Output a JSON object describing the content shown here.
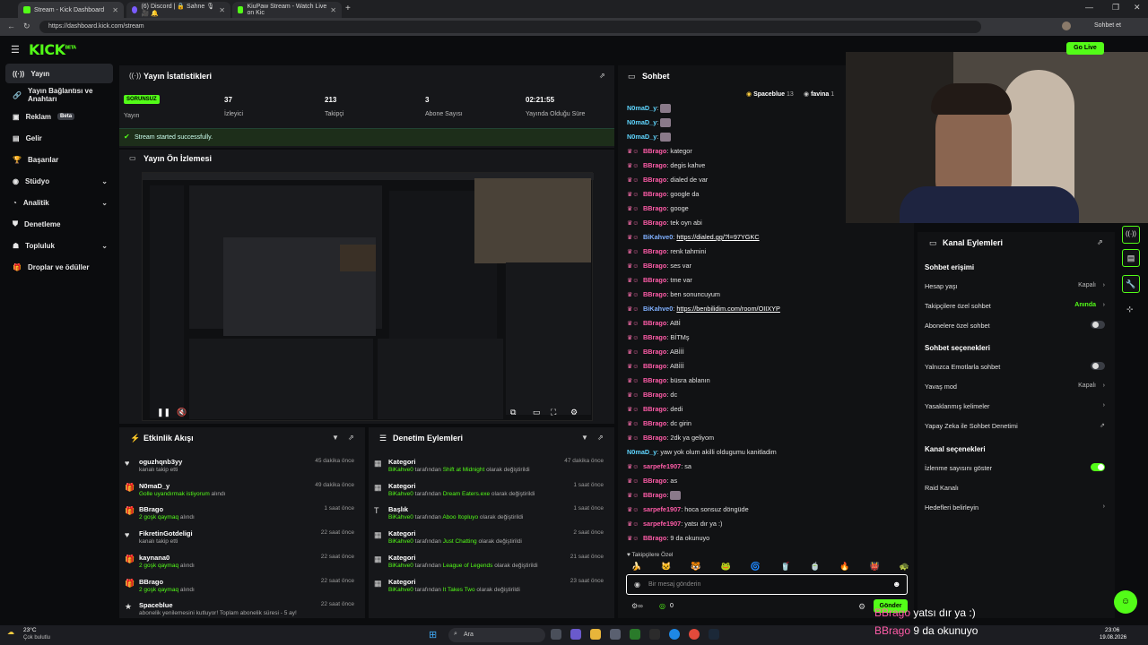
{
  "browser": {
    "tabs": [
      {
        "label": "Stream - Kick Dashboard",
        "active": true
      },
      {
        "label": "(6) Discord | 🔒 Sahne 🎙 🎥 🔔",
        "active": false
      },
      {
        "label": "KiuPaw Stream - Watch Live on Kic",
        "active": false
      }
    ],
    "url": "https://dashboard.kick.com/stream",
    "profile_button": "Sohbet et"
  },
  "header": {
    "logo": "KICK",
    "logo_sup": "BETA",
    "go_live": "Go Live"
  },
  "sidebar": {
    "items": [
      {
        "label": "Yayın",
        "icon": "broadcast-icon",
        "active": true
      },
      {
        "label": "Yayın Bağlantısı ve Anahtarı",
        "icon": "link-icon"
      },
      {
        "label": "Reklam",
        "icon": "ad-icon",
        "badge": "Beta"
      },
      {
        "label": "Gelir",
        "icon": "revenue-icon"
      },
      {
        "label": "Başarılar",
        "icon": "trophy-icon"
      },
      {
        "label": "Stüdyo",
        "icon": "studio-icon",
        "chevron": true
      },
      {
        "label": "Analitik",
        "icon": "analytics-icon",
        "chevron": true
      },
      {
        "label": "Denetleme",
        "icon": "moderation-icon"
      },
      {
        "label": "Topluluk",
        "icon": "community-icon",
        "chevron": true
      },
      {
        "label": "Droplar ve ödüller",
        "icon": "gift-icon"
      }
    ]
  },
  "stats": {
    "title": "Yayın İstatistikleri",
    "status_badge": "SORUNSUZ",
    "status_label": "Yayın",
    "viewers": "37",
    "viewers_label": "İzleyici",
    "followers": "213",
    "followers_label": "Takipçi",
    "subs": "3",
    "subs_label": "Abone Sayısı",
    "uptime": "02:21:55",
    "uptime_label": "Yayında Olduğu Süre",
    "success_msg": "Stream started successfully."
  },
  "preview": {
    "title": "Yayın Ön İzlemesi"
  },
  "activity": {
    "title": "Etkinlik Akışı",
    "rows": [
      {
        "icon": "heart-icon",
        "title": "oguzhqnb3yy",
        "sub": "kanalı takip etti",
        "time": "45 dakika önce"
      },
      {
        "icon": "gift-icon",
        "title": "N0maD_y",
        "sub_green": "Golle uyandırmak istiyorum",
        "sub": " alındı",
        "time": "49 dakika önce"
      },
      {
        "icon": "gift-icon",
        "title": "BBrago",
        "sub_green": "2 goşk qaymaq",
        "sub": " alındı",
        "time": "1 saat önce"
      },
      {
        "icon": "heart-icon",
        "title": "FikretinGotdeligi",
        "sub": "kanalı takip etti",
        "time": "22 saat önce"
      },
      {
        "icon": "gift-icon",
        "title": "kaynana0",
        "sub_green": "2 goşk qaymaq",
        "sub": " alındı",
        "time": "22 saat önce"
      },
      {
        "icon": "gift-icon",
        "title": "BBrago",
        "sub_green": "2 goşk qaymaq",
        "sub": " alındı",
        "time": "22 saat önce"
      },
      {
        "icon": "star-icon",
        "title": "Spaceblue",
        "sub": "abonelik yenilemesini kutluyor! Toplam abonelik süresi - 5 ay!",
        "time": "22 saat önce"
      }
    ]
  },
  "modactions": {
    "title": "Denetim Eylemleri",
    "rows": [
      {
        "icon": "category-icon",
        "title": "Kategori",
        "user": "BiKahve0",
        "mid": " tarafından ",
        "value": "Shift at Midnight",
        "end": " olarak değiştirildi",
        "time": "47 dakika önce"
      },
      {
        "icon": "category-icon",
        "title": "Kategori",
        "user": "BiKahve0",
        "mid": " tarafından ",
        "value": "Dream Eaters.exe",
        "end": " olarak değiştirildi",
        "time": "1 saat önce"
      },
      {
        "icon": "title-icon",
        "title": "Başlık",
        "user": "BiKahve0",
        "mid": " tarafından ",
        "value": "Aboo Itopluyo",
        "end": " olarak değiştirildi",
        "time": "1 saat önce"
      },
      {
        "icon": "category-icon",
        "title": "Kategori",
        "user": "BiKahve0",
        "mid": " tarafından ",
        "value": "Just Chatting",
        "end": " olarak değiştirildi",
        "time": "2 saat önce"
      },
      {
        "icon": "category-icon",
        "title": "Kategori",
        "user": "BiKahve0",
        "mid": " tarafından ",
        "value": "League of Legends",
        "end": " olarak değiştirildi",
        "time": "21 saat önce"
      },
      {
        "icon": "category-icon",
        "title": "Kategori",
        "user": "BiKahve0",
        "mid": " tarafından ",
        "value": "It Takes Two",
        "end": " olarak değiştirildi",
        "time": "23 saat önce"
      }
    ]
  },
  "chat": {
    "title": "Sohbet",
    "pinned_users": [
      {
        "name": "Spaceblue",
        "count": "13"
      },
      {
        "name": "favina",
        "count": "1"
      }
    ],
    "messages": [
      {
        "user": "N0maD_y",
        "color": "cyan",
        "text": ""
      },
      {
        "user": "N0maD_y",
        "color": "cyan",
        "text": ""
      },
      {
        "user": "N0maD_y",
        "color": "cyan",
        "text": ""
      },
      {
        "user": "BBrago",
        "color": "pink",
        "text": "kategor"
      },
      {
        "user": "BBrago",
        "color": "pink",
        "text": "degis kahve"
      },
      {
        "user": "BBrago",
        "color": "pink",
        "text": "dialed de var"
      },
      {
        "user": "BBrago",
        "color": "pink",
        "text": "google da"
      },
      {
        "user": "BBrago",
        "color": "pink",
        "text": "googe"
      },
      {
        "user": "BBrago",
        "color": "pink",
        "text": "tek oyn abi"
      },
      {
        "user": "BiKahve0",
        "color": "blue",
        "text": "https://dialed.gg/?l=97YGKC",
        "link": true
      },
      {
        "user": "BBrago",
        "color": "pink",
        "text": "renk tahmini"
      },
      {
        "user": "BBrago",
        "color": "pink",
        "text": "ses var"
      },
      {
        "user": "BBrago",
        "color": "pink",
        "text": "tme var"
      },
      {
        "user": "BBrago",
        "color": "pink",
        "text": "ben sonuncuyum"
      },
      {
        "user": "BiKahve0",
        "color": "blue",
        "text": "https://benbilidim.com/room/OIIXYP",
        "link": true
      },
      {
        "user": "BBrago",
        "color": "pink",
        "text": "ABİ"
      },
      {
        "user": "BBrago",
        "color": "pink",
        "text": "BİTMş"
      },
      {
        "user": "BBrago",
        "color": "pink",
        "text": "ABİİİ"
      },
      {
        "user": "BBrago",
        "color": "pink",
        "text": "ABİİİ"
      },
      {
        "user": "BBrago",
        "color": "pink",
        "text": "büsra ablanın"
      },
      {
        "user": "BBrago",
        "color": "pink",
        "text": "dc"
      },
      {
        "user": "BBrago",
        "color": "pink",
        "text": "dedi"
      },
      {
        "user": "BBrago",
        "color": "pink",
        "text": "dc girin"
      },
      {
        "user": "BBrago",
        "color": "pink",
        "text": "2dk ya geliyom"
      },
      {
        "user": "N0maD_y",
        "color": "cyan",
        "text": "yaw yok olum akilli oldugumu kanitladim"
      },
      {
        "user": "sarpefe1907",
        "color": "pink",
        "text": "sa"
      },
      {
        "user": "BBrago",
        "color": "pink",
        "text": "as"
      },
      {
        "user": "BBrago",
        "color": "pink",
        "text": ""
      },
      {
        "user": "sarpefe1907",
        "color": "pink",
        "text": "hoca sonsuz döngüde"
      },
      {
        "user": "sarpefe1907",
        "color": "pink",
        "text": "yatsı dır ya :)"
      },
      {
        "user": "BBrago",
        "color": "pink",
        "text": "9 da okunuyo"
      }
    ],
    "emote_label": "♥ Takipçilere Özel",
    "input_placeholder": "Bir mesaj gönderin",
    "points": "0",
    "send_label": "Gönder"
  },
  "channel_actions": {
    "title": "Kanal Eylemleri",
    "section1": "Sohbet erişimi",
    "rows1": [
      {
        "label": "Hesap yaşı",
        "value": "Kapalı",
        "kind": "chevron"
      },
      {
        "label": "Takipçilere özel sohbet",
        "value": "Anında",
        "kind": "chevron",
        "green": true
      },
      {
        "label": "Abonelere özel sohbet",
        "kind": "toggle",
        "on": false
      }
    ],
    "section2": "Sohbet seçenekleri",
    "rows2": [
      {
        "label": "Yalnızca Emotlarla sohbet",
        "kind": "toggle",
        "on": false
      },
      {
        "label": "Yavaş mod",
        "value": "Kapalı",
        "kind": "chevron"
      },
      {
        "label": "Yasaklanmış kelimeler",
        "kind": "chevron"
      },
      {
        "label": "Yapay Zeka ile Sohbet Denetimi",
        "kind": "external"
      }
    ],
    "section3": "Kanal seçenekleri",
    "rows3": [
      {
        "label": "İzlenme sayısını göster",
        "kind": "toggle",
        "on": true
      },
      {
        "label": "Raid Kanalı",
        "kind": "none"
      },
      {
        "label": "Hedefleri belirleyin",
        "kind": "chevron"
      }
    ]
  },
  "overlay": {
    "line1_user": "BBrago",
    "line1_text": "yatsı dır ya :)",
    "line2_user": "BBrago",
    "line2_text": "9 da okunuyo"
  },
  "taskbar": {
    "weather_temp": "23°C",
    "weather_desc": "Çok bulutlu",
    "search": "Ara",
    "time": "23:06",
    "date": "19.08.2026"
  },
  "colors": {
    "accent": "#53fc18",
    "pink": "#ff5ca8",
    "cyan": "#5fd6ff"
  }
}
